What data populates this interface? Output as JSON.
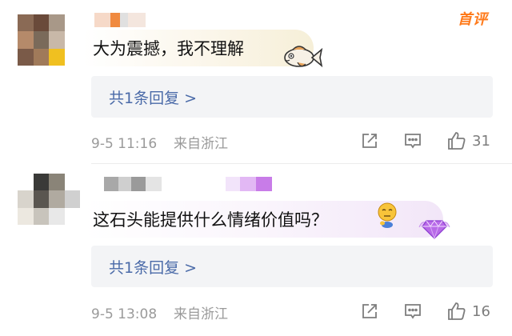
{
  "top_badge": "首评",
  "comments": [
    {
      "text": "大为震撼，我不理解",
      "reply_link": "共1条回复 >",
      "timestamp": "9-5 11:16",
      "location": "来自浙江",
      "likes": "31",
      "sticker_icon": "fish-icon"
    },
    {
      "text": "这石头能提供什么情绪价值吗？",
      "reply_link": "共1条回复 >",
      "timestamp": "9-5 13:08",
      "location": "来自浙江",
      "likes": "16",
      "sticker_icon": "thinking-face-icon",
      "badge_icon": "diamond-badge-icon"
    }
  ],
  "colors": {
    "accent_orange": "#ff7a1a",
    "link_blue": "#4a6aa8",
    "reply_bg": "#f3f4f6",
    "meta_gray": "#9a9a9a"
  }
}
